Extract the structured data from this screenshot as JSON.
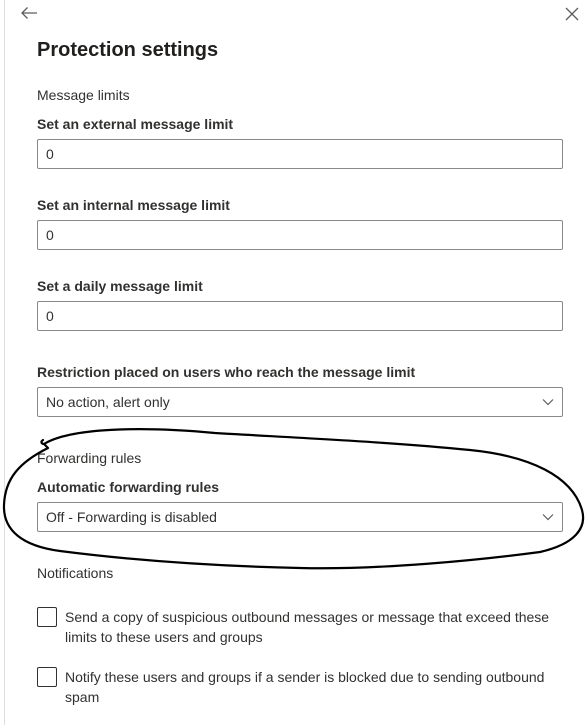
{
  "panel": {
    "title": "Protection settings"
  },
  "message_limits": {
    "section_title": "Message limits",
    "external": {
      "label": "Set an external message limit",
      "value": "0"
    },
    "internal": {
      "label": "Set an internal message limit",
      "value": "0"
    },
    "daily": {
      "label": "Set a daily message limit",
      "value": "0"
    },
    "restriction": {
      "label": "Restriction placed on users who reach the message limit",
      "selected": "No action, alert only"
    }
  },
  "forwarding": {
    "section_title": "Forwarding rules",
    "automatic": {
      "label": "Automatic forwarding rules",
      "selected": "Off - Forwarding is disabled"
    }
  },
  "notifications": {
    "section_title": "Notifications",
    "copy_checkbox": {
      "label": "Send a copy of suspicious outbound messages or message that exceed these limits to these users and groups",
      "checked": false
    },
    "notify_checkbox": {
      "label": "Notify these users and groups if a sender is blocked due to sending outbound spam",
      "checked": false
    }
  },
  "icons": {
    "back": "arrow-left-icon",
    "close": "close-icon",
    "dropdown": "chevron-down-icon"
  },
  "colors": {
    "text": "#323130",
    "title": "#201f1e",
    "border": "#8a8886",
    "annotation": "#000000"
  }
}
